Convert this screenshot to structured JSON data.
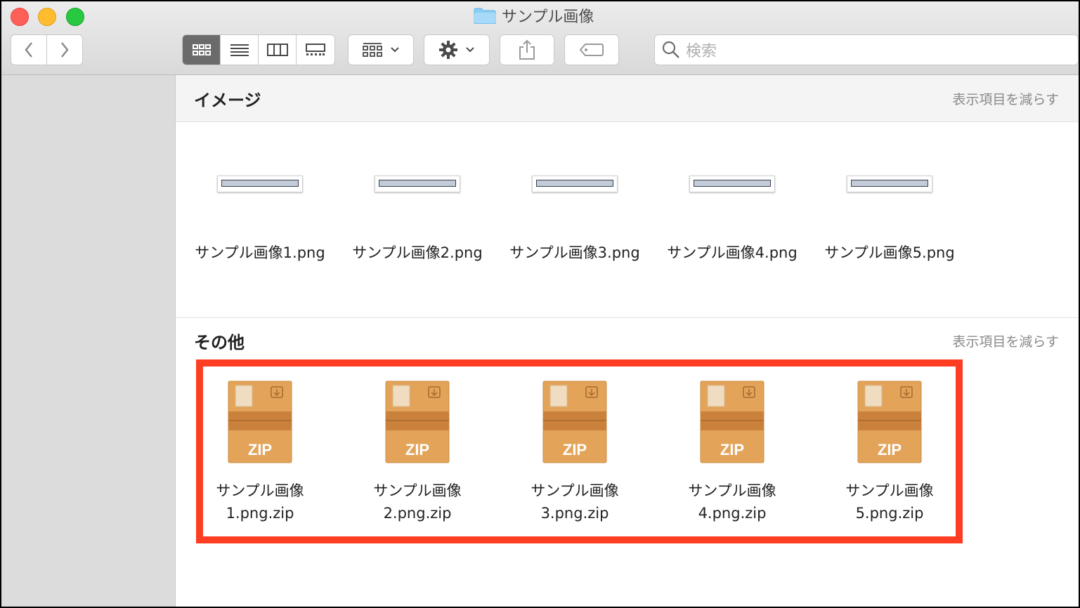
{
  "window": {
    "title": "サンプル画像"
  },
  "toolbar": {
    "search_placeholder": "検索"
  },
  "sections": [
    {
      "title": "イメージ",
      "link": "表示項目を減らす",
      "items": [
        "サンプル画像1.png",
        "サンプル画像2.png",
        "サンプル画像3.png",
        "サンプル画像4.png",
        "サンプル画像5.png"
      ]
    },
    {
      "title": "その他",
      "link": "表示項目を減らす",
      "items": [
        {
          "line1": "サンプル画像",
          "line2": "1.png.zip"
        },
        {
          "line1": "サンプル画像",
          "line2": "2.png.zip"
        },
        {
          "line1": "サンプル画像",
          "line2": "3.png.zip"
        },
        {
          "line1": "サンプル画像",
          "line2": "4.png.zip"
        },
        {
          "line1": "サンプル画像",
          "line2": "5.png.zip"
        }
      ]
    }
  ],
  "zip_label": "ZIP",
  "colors": {
    "highlight": "#fd3e22",
    "zip_body": "#e3a45a",
    "zip_band": "#c9813b"
  }
}
